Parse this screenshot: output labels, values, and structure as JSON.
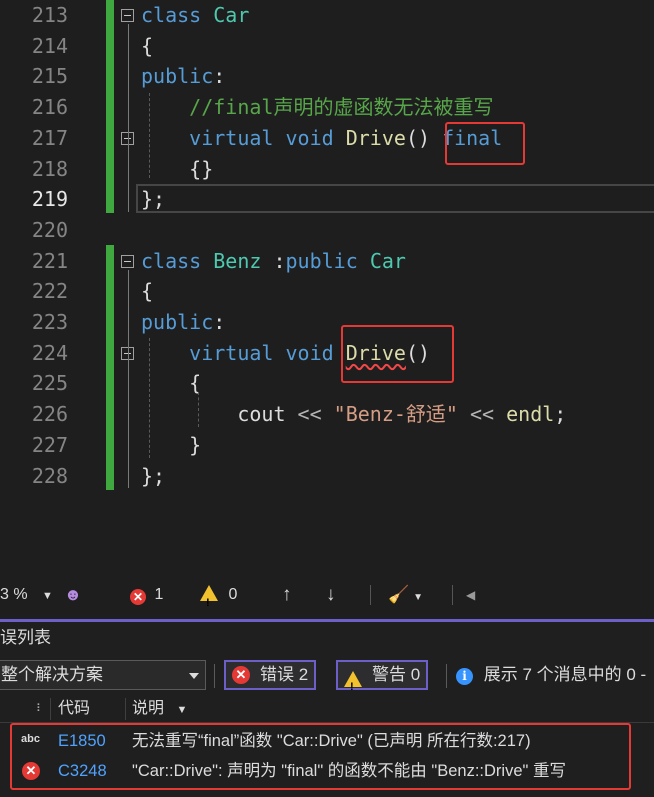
{
  "editor": {
    "lines": [
      {
        "n": "213",
        "tokens": [
          {
            "t": "class ",
            "c": "kw"
          },
          {
            "t": "Car",
            "c": "ty"
          }
        ]
      },
      {
        "n": "214",
        "tokens": [
          {
            "t": "{",
            "c": ""
          }
        ]
      },
      {
        "n": "215",
        "tokens": [
          {
            "t": "public",
            "c": "kw"
          },
          {
            "t": ":",
            "c": ""
          }
        ]
      },
      {
        "n": "216",
        "tokens": [
          {
            "t": "    //final声明的虚函数无法被重写",
            "c": "cm"
          }
        ]
      },
      {
        "n": "217",
        "tokens": [
          {
            "t": "    ",
            "c": ""
          },
          {
            "t": "virtual ",
            "c": "kw"
          },
          {
            "t": "void ",
            "c": "kw"
          },
          {
            "t": "Drive",
            "c": "fn"
          },
          {
            "t": "() ",
            "c": ""
          },
          {
            "t": "final",
            "c": "kw"
          }
        ]
      },
      {
        "n": "218",
        "tokens": [
          {
            "t": "    {}",
            "c": ""
          }
        ]
      },
      {
        "n": "219",
        "tokens": [
          {
            "t": "};",
            "c": ""
          }
        ]
      },
      {
        "n": "220",
        "tokens": []
      },
      {
        "n": "221",
        "tokens": [
          {
            "t": "class ",
            "c": "kw"
          },
          {
            "t": "Benz ",
            "c": "ty"
          },
          {
            "t": ":",
            "c": ""
          },
          {
            "t": "public ",
            "c": "kw"
          },
          {
            "t": "Car",
            "c": "ty"
          }
        ]
      },
      {
        "n": "222",
        "tokens": [
          {
            "t": "{",
            "c": ""
          }
        ]
      },
      {
        "n": "223",
        "tokens": [
          {
            "t": "public",
            "c": "kw"
          },
          {
            "t": ":",
            "c": ""
          }
        ]
      },
      {
        "n": "224",
        "tokens": [
          {
            "t": "    ",
            "c": ""
          },
          {
            "t": "virtual ",
            "c": "kw"
          },
          {
            "t": "void ",
            "c": "kw"
          },
          {
            "t": "Drive",
            "c": "fn sq"
          },
          {
            "t": "()",
            "c": ""
          }
        ]
      },
      {
        "n": "225",
        "tokens": [
          {
            "t": "    {",
            "c": ""
          }
        ]
      },
      {
        "n": "226",
        "tokens": [
          {
            "t": "        cout ",
            "c": ""
          },
          {
            "t": "<< ",
            "c": "op"
          },
          {
            "t": "\"Benz-舒适\" ",
            "c": "st"
          },
          {
            "t": "<< ",
            "c": "op"
          },
          {
            "t": "endl",
            "c": "fn"
          },
          {
            "t": ";",
            "c": ""
          }
        ]
      },
      {
        "n": "227",
        "tokens": [
          {
            "t": "    }",
            "c": ""
          }
        ]
      },
      {
        "n": "228",
        "tokens": [
          {
            "t": "};",
            "c": ""
          }
        ]
      }
    ],
    "current_line": "219"
  },
  "statusbar": {
    "zoom": "3 %",
    "errors": "1",
    "warnings": "0"
  },
  "error_list": {
    "title": "误列表",
    "scope": "整个解决方案",
    "errors_btn": "错误 2",
    "warnings_btn": "警告 0",
    "messages_text": "展示 7 个消息中的 0 -",
    "col_code": "代码",
    "col_desc": "说明",
    "rows": [
      {
        "code": "E1850",
        "desc": "无法重写“final”函数 \"Car::Drive\" (已声明 所在行数:217)"
      },
      {
        "code": "C3248",
        "desc": "\"Car::Drive\": 声明为 \"final\" 的函数不能由 \"Benz::Drive\" 重写"
      }
    ]
  },
  "colors": {
    "keyword": "#569cd6",
    "type": "#4ec9b0",
    "function": "#dcdcaa",
    "comment": "#57a64a",
    "string": "#d69d85",
    "highlight": "#e53935",
    "accent": "#6c5fc7"
  }
}
